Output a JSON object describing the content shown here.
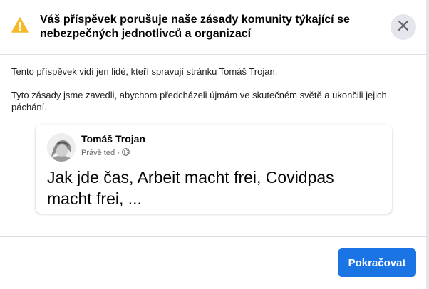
{
  "dialog": {
    "title": "Váš příspěvek porušuje naše zásady komunity týkající se nebezpečných jednotlivců a organizací",
    "icons": {
      "warning": "warning-icon",
      "close": "close-icon"
    },
    "body": {
      "visibility_note": "Tento příspěvek vidí jen lidé, kteří spravují stránku Tomáš Trojan.",
      "policy_note": "Tyto zásady jsme zavedli, abychom předcházeli újmám ve skutečném světě a ukončili jejich páchání."
    },
    "post": {
      "author": "Tomáš Trojan",
      "time": "Právě teď",
      "separator": "·",
      "privacy_icon": "globe-icon",
      "text": "Jak jde čas, Arbeit macht frei, Covidpas macht frei, ..."
    },
    "footer": {
      "continue_label": "Pokračovat"
    }
  },
  "colors": {
    "warning": "#f7b928",
    "primary_button": "#1b74e4",
    "close_bg": "#e4e6eb",
    "secondary_text": "#65676b"
  }
}
